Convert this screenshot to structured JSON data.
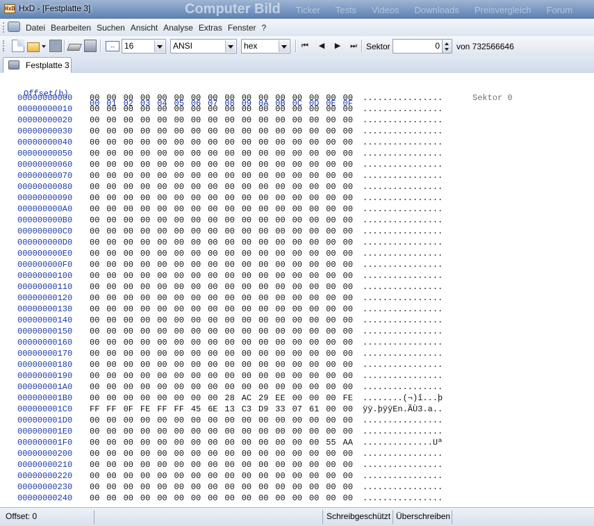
{
  "window": {
    "title": "HxD - [Festplatte 3]",
    "app_icon_text": "HxD",
    "background_text": [
      "Computer Bild",
      "Ticker",
      "Tests",
      "Videos",
      "Downloads",
      "Preisvergleich",
      "Forum"
    ]
  },
  "menu": {
    "items": [
      "Datei",
      "Bearbeiten",
      "Suchen",
      "Ansicht",
      "Analyse",
      "Extras",
      "Fenster",
      "?"
    ]
  },
  "toolbar": {
    "icons": [
      "new-file-icon",
      "open-file-icon",
      "save-icon",
      "open-disk-icon",
      "open-ram-icon",
      "bytes-per-row-icon"
    ],
    "bytes_per_row": "16",
    "charset": "ANSI",
    "offset_base": "hex",
    "sector_label": "Sektor",
    "sector_value": "0",
    "sector_total_label": "von 732566646",
    "nav_icons": [
      "first-sector-icon",
      "previous-sector-icon",
      "next-sector-icon",
      "last-sector-icon"
    ]
  },
  "tabs": [
    {
      "label": "Festplatte 3",
      "icon": "disk-icon",
      "active": true
    }
  ],
  "hexview": {
    "offset_header": "Offset(h)",
    "columns": [
      "00",
      "01",
      "02",
      "03",
      "04",
      "05",
      "06",
      "07",
      "08",
      "09",
      "0A",
      "0B",
      "0C",
      "0D",
      "0E",
      "0F"
    ],
    "sector_note": "Sektor 0",
    "rows": [
      {
        "offset": "00000000000",
        "bytes": [
          "00",
          "00",
          "00",
          "00",
          "00",
          "00",
          "00",
          "00",
          "00",
          "00",
          "00",
          "00",
          "00",
          "00",
          "00",
          "00"
        ],
        "ascii": "................"
      },
      {
        "offset": "00000000010",
        "bytes": [
          "00",
          "00",
          "00",
          "00",
          "00",
          "00",
          "00",
          "00",
          "00",
          "00",
          "00",
          "00",
          "00",
          "00",
          "00",
          "00"
        ],
        "ascii": "................"
      },
      {
        "offset": "00000000020",
        "bytes": [
          "00",
          "00",
          "00",
          "00",
          "00",
          "00",
          "00",
          "00",
          "00",
          "00",
          "00",
          "00",
          "00",
          "00",
          "00",
          "00"
        ],
        "ascii": "................"
      },
      {
        "offset": "00000000030",
        "bytes": [
          "00",
          "00",
          "00",
          "00",
          "00",
          "00",
          "00",
          "00",
          "00",
          "00",
          "00",
          "00",
          "00",
          "00",
          "00",
          "00"
        ],
        "ascii": "................"
      },
      {
        "offset": "00000000040",
        "bytes": [
          "00",
          "00",
          "00",
          "00",
          "00",
          "00",
          "00",
          "00",
          "00",
          "00",
          "00",
          "00",
          "00",
          "00",
          "00",
          "00"
        ],
        "ascii": "................"
      },
      {
        "offset": "00000000050",
        "bytes": [
          "00",
          "00",
          "00",
          "00",
          "00",
          "00",
          "00",
          "00",
          "00",
          "00",
          "00",
          "00",
          "00",
          "00",
          "00",
          "00"
        ],
        "ascii": "................"
      },
      {
        "offset": "00000000060",
        "bytes": [
          "00",
          "00",
          "00",
          "00",
          "00",
          "00",
          "00",
          "00",
          "00",
          "00",
          "00",
          "00",
          "00",
          "00",
          "00",
          "00"
        ],
        "ascii": "................"
      },
      {
        "offset": "00000000070",
        "bytes": [
          "00",
          "00",
          "00",
          "00",
          "00",
          "00",
          "00",
          "00",
          "00",
          "00",
          "00",
          "00",
          "00",
          "00",
          "00",
          "00"
        ],
        "ascii": "................"
      },
      {
        "offset": "00000000080",
        "bytes": [
          "00",
          "00",
          "00",
          "00",
          "00",
          "00",
          "00",
          "00",
          "00",
          "00",
          "00",
          "00",
          "00",
          "00",
          "00",
          "00"
        ],
        "ascii": "................"
      },
      {
        "offset": "00000000090",
        "bytes": [
          "00",
          "00",
          "00",
          "00",
          "00",
          "00",
          "00",
          "00",
          "00",
          "00",
          "00",
          "00",
          "00",
          "00",
          "00",
          "00"
        ],
        "ascii": "................"
      },
      {
        "offset": "000000000A0",
        "bytes": [
          "00",
          "00",
          "00",
          "00",
          "00",
          "00",
          "00",
          "00",
          "00",
          "00",
          "00",
          "00",
          "00",
          "00",
          "00",
          "00"
        ],
        "ascii": "................"
      },
      {
        "offset": "000000000B0",
        "bytes": [
          "00",
          "00",
          "00",
          "00",
          "00",
          "00",
          "00",
          "00",
          "00",
          "00",
          "00",
          "00",
          "00",
          "00",
          "00",
          "00"
        ],
        "ascii": "................"
      },
      {
        "offset": "000000000C0",
        "bytes": [
          "00",
          "00",
          "00",
          "00",
          "00",
          "00",
          "00",
          "00",
          "00",
          "00",
          "00",
          "00",
          "00",
          "00",
          "00",
          "00"
        ],
        "ascii": "................"
      },
      {
        "offset": "000000000D0",
        "bytes": [
          "00",
          "00",
          "00",
          "00",
          "00",
          "00",
          "00",
          "00",
          "00",
          "00",
          "00",
          "00",
          "00",
          "00",
          "00",
          "00"
        ],
        "ascii": "................"
      },
      {
        "offset": "000000000E0",
        "bytes": [
          "00",
          "00",
          "00",
          "00",
          "00",
          "00",
          "00",
          "00",
          "00",
          "00",
          "00",
          "00",
          "00",
          "00",
          "00",
          "00"
        ],
        "ascii": "................"
      },
      {
        "offset": "000000000F0",
        "bytes": [
          "00",
          "00",
          "00",
          "00",
          "00",
          "00",
          "00",
          "00",
          "00",
          "00",
          "00",
          "00",
          "00",
          "00",
          "00",
          "00"
        ],
        "ascii": "................"
      },
      {
        "offset": "00000000100",
        "bytes": [
          "00",
          "00",
          "00",
          "00",
          "00",
          "00",
          "00",
          "00",
          "00",
          "00",
          "00",
          "00",
          "00",
          "00",
          "00",
          "00"
        ],
        "ascii": "................"
      },
      {
        "offset": "00000000110",
        "bytes": [
          "00",
          "00",
          "00",
          "00",
          "00",
          "00",
          "00",
          "00",
          "00",
          "00",
          "00",
          "00",
          "00",
          "00",
          "00",
          "00"
        ],
        "ascii": "................"
      },
      {
        "offset": "00000000120",
        "bytes": [
          "00",
          "00",
          "00",
          "00",
          "00",
          "00",
          "00",
          "00",
          "00",
          "00",
          "00",
          "00",
          "00",
          "00",
          "00",
          "00"
        ],
        "ascii": "................"
      },
      {
        "offset": "00000000130",
        "bytes": [
          "00",
          "00",
          "00",
          "00",
          "00",
          "00",
          "00",
          "00",
          "00",
          "00",
          "00",
          "00",
          "00",
          "00",
          "00",
          "00"
        ],
        "ascii": "................"
      },
      {
        "offset": "00000000140",
        "bytes": [
          "00",
          "00",
          "00",
          "00",
          "00",
          "00",
          "00",
          "00",
          "00",
          "00",
          "00",
          "00",
          "00",
          "00",
          "00",
          "00"
        ],
        "ascii": "................"
      },
      {
        "offset": "00000000150",
        "bytes": [
          "00",
          "00",
          "00",
          "00",
          "00",
          "00",
          "00",
          "00",
          "00",
          "00",
          "00",
          "00",
          "00",
          "00",
          "00",
          "00"
        ],
        "ascii": "................"
      },
      {
        "offset": "00000000160",
        "bytes": [
          "00",
          "00",
          "00",
          "00",
          "00",
          "00",
          "00",
          "00",
          "00",
          "00",
          "00",
          "00",
          "00",
          "00",
          "00",
          "00"
        ],
        "ascii": "................"
      },
      {
        "offset": "00000000170",
        "bytes": [
          "00",
          "00",
          "00",
          "00",
          "00",
          "00",
          "00",
          "00",
          "00",
          "00",
          "00",
          "00",
          "00",
          "00",
          "00",
          "00"
        ],
        "ascii": "................"
      },
      {
        "offset": "00000000180",
        "bytes": [
          "00",
          "00",
          "00",
          "00",
          "00",
          "00",
          "00",
          "00",
          "00",
          "00",
          "00",
          "00",
          "00",
          "00",
          "00",
          "00"
        ],
        "ascii": "................"
      },
      {
        "offset": "00000000190",
        "bytes": [
          "00",
          "00",
          "00",
          "00",
          "00",
          "00",
          "00",
          "00",
          "00",
          "00",
          "00",
          "00",
          "00",
          "00",
          "00",
          "00"
        ],
        "ascii": "................"
      },
      {
        "offset": "000000001A0",
        "bytes": [
          "00",
          "00",
          "00",
          "00",
          "00",
          "00",
          "00",
          "00",
          "00",
          "00",
          "00",
          "00",
          "00",
          "00",
          "00",
          "00"
        ],
        "ascii": "................"
      },
      {
        "offset": "000000001B0",
        "bytes": [
          "00",
          "00",
          "00",
          "00",
          "00",
          "00",
          "00",
          "00",
          "28",
          "AC",
          "29",
          "EE",
          "00",
          "00",
          "00",
          "FE"
        ],
        "ascii": "........(¬)î...þ"
      },
      {
        "offset": "000000001C0",
        "bytes": [
          "FF",
          "FF",
          "0F",
          "FE",
          "FF",
          "FF",
          "45",
          "6E",
          "13",
          "C3",
          "D9",
          "33",
          "07",
          "61",
          "00",
          "00"
        ],
        "ascii": "ÿÿ.þÿÿEn.ÃÙ3.a.."
      },
      {
        "offset": "000000001D0",
        "bytes": [
          "00",
          "00",
          "00",
          "00",
          "00",
          "00",
          "00",
          "00",
          "00",
          "00",
          "00",
          "00",
          "00",
          "00",
          "00",
          "00"
        ],
        "ascii": "................"
      },
      {
        "offset": "000000001E0",
        "bytes": [
          "00",
          "00",
          "00",
          "00",
          "00",
          "00",
          "00",
          "00",
          "00",
          "00",
          "00",
          "00",
          "00",
          "00",
          "00",
          "00"
        ],
        "ascii": "................"
      },
      {
        "offset": "000000001F0",
        "bytes": [
          "00",
          "00",
          "00",
          "00",
          "00",
          "00",
          "00",
          "00",
          "00",
          "00",
          "00",
          "00",
          "00",
          "00",
          "55",
          "AA"
        ],
        "ascii": "..............Uª"
      },
      {
        "offset": "00000000200",
        "bytes": [
          "00",
          "00",
          "00",
          "00",
          "00",
          "00",
          "00",
          "00",
          "00",
          "00",
          "00",
          "00",
          "00",
          "00",
          "00",
          "00"
        ],
        "ascii": "................"
      },
      {
        "offset": "00000000210",
        "bytes": [
          "00",
          "00",
          "00",
          "00",
          "00",
          "00",
          "00",
          "00",
          "00",
          "00",
          "00",
          "00",
          "00",
          "00",
          "00",
          "00"
        ],
        "ascii": "................"
      },
      {
        "offset": "00000000220",
        "bytes": [
          "00",
          "00",
          "00",
          "00",
          "00",
          "00",
          "00",
          "00",
          "00",
          "00",
          "00",
          "00",
          "00",
          "00",
          "00",
          "00"
        ],
        "ascii": "................"
      },
      {
        "offset": "00000000230",
        "bytes": [
          "00",
          "00",
          "00",
          "00",
          "00",
          "00",
          "00",
          "00",
          "00",
          "00",
          "00",
          "00",
          "00",
          "00",
          "00",
          "00"
        ],
        "ascii": "................"
      },
      {
        "offset": "00000000240",
        "bytes": [
          "00",
          "00",
          "00",
          "00",
          "00",
          "00",
          "00",
          "00",
          "00",
          "00",
          "00",
          "00",
          "00",
          "00",
          "00",
          "00"
        ],
        "ascii": "................"
      }
    ]
  },
  "status": {
    "offset": "Offset: 0",
    "write_protected": "Schreibgeschützt",
    "mode": "Überschreiben"
  },
  "colors": {
    "offset_blue": "#1a3aa8",
    "title_bar": "#7f9cc6"
  }
}
